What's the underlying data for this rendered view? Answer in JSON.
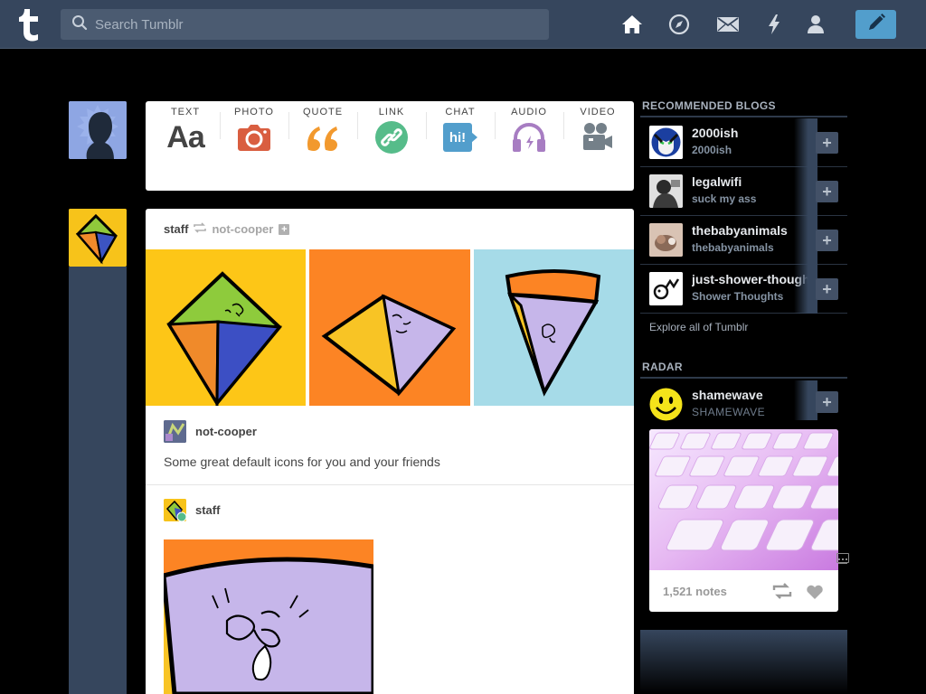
{
  "header": {
    "search_placeholder": "Search Tumblr",
    "nav": [
      "home-icon",
      "explore-compass-icon",
      "inbox-envelope-icon",
      "activity-bolt-icon",
      "account-person-icon"
    ],
    "compose_icon": "pencil-icon",
    "bg_color": "#36465d",
    "accent_color": "#529ecc"
  },
  "post_types": [
    {
      "label": "TEXT",
      "glyph": "Aa",
      "color": "#444444"
    },
    {
      "label": "PHOTO",
      "color": "#d95e40"
    },
    {
      "label": "QUOTE",
      "color": "#f2992e"
    },
    {
      "label": "LINK",
      "color": "#56bc8a"
    },
    {
      "label": "CHAT",
      "glyph": "hi!",
      "color": "#529ecc"
    },
    {
      "label": "AUDIO",
      "color": "#a77dc2"
    },
    {
      "label": "VIDEO",
      "color": "#748089"
    }
  ],
  "post": {
    "author": "staff",
    "reblogged_from": "not-cooper",
    "reblog_user": "not-cooper",
    "caption": "Some great default icons for you and your friends",
    "second_user": "staff"
  },
  "sidebar": {
    "recommended_title": "RECOMMENDED BLOGS",
    "blogs": [
      {
        "name": "2000ish",
        "sub": "2000ish"
      },
      {
        "name": "legalwifi",
        "sub": "suck my ass"
      },
      {
        "name": "thebabyanimals",
        "sub": "thebabyanimals"
      },
      {
        "name": "just-shower-thoughts",
        "sub": "Shower Thoughts"
      }
    ],
    "explore": "Explore all of Tumblr",
    "radar_title": "RADAR",
    "radar_blog": {
      "name": "shamewave",
      "sub": "SHAMEWAVE"
    },
    "radar_notes": "1,521 notes",
    "follow_label": "+"
  }
}
